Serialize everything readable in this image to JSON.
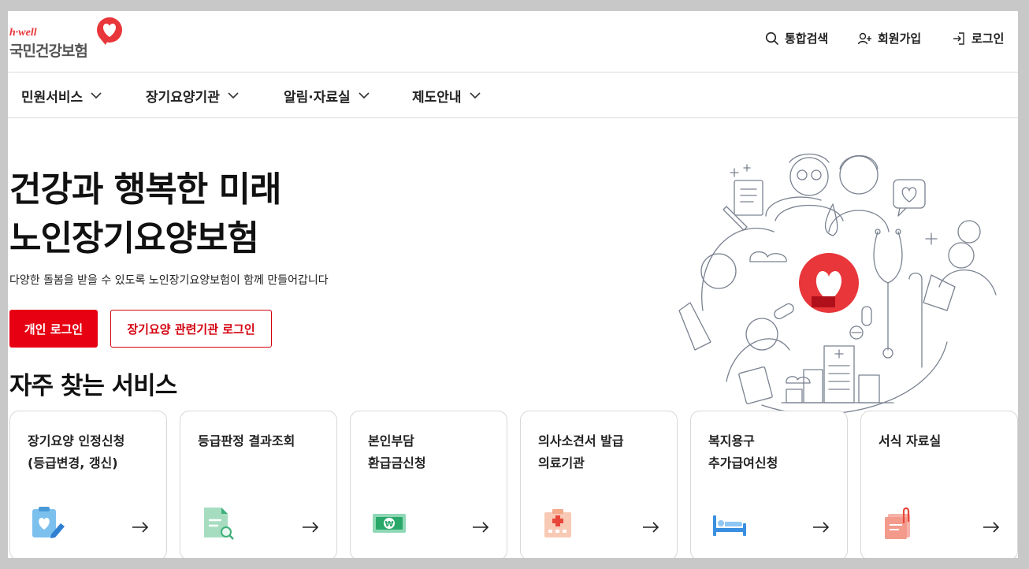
{
  "header": {
    "logo_brand": "h·well",
    "logo_name": "국민건강보험",
    "search_label": "통합검색",
    "join_label": "회원가입",
    "login_label": "로그인"
  },
  "nav": {
    "items": [
      {
        "label": "민원서비스"
      },
      {
        "label": "장기요양기관"
      },
      {
        "label": "알림·자료실"
      },
      {
        "label": "제도안내"
      }
    ]
  },
  "hero": {
    "title_line1": "건강과 행복한 미래",
    "title_line2": "노인장기요양보험",
    "description": "다양한 돌봄을 받을 수 있도록 노인장기요양보험이 함께 만들어갑니다",
    "personal_login": "개인 로그인",
    "institution_login": "장기요양 관련기관 로그인"
  },
  "services": {
    "title": "자주 찾는 서비스",
    "cards": [
      {
        "title": "장기요양 인정신청\n(등급변경, 갱신)",
        "icon": "clipboard-heart-icon"
      },
      {
        "title": "등급판정 결과조회",
        "icon": "document-search-icon"
      },
      {
        "title": "본인부담\n환급금신청",
        "icon": "won-money-icon"
      },
      {
        "title": "의사소견서 발급\n의료기관",
        "icon": "hospital-icon"
      },
      {
        "title": "복지용구\n추가급여신청",
        "icon": "bed-icon"
      },
      {
        "title": "서식 자료실",
        "icon": "paper-clip-file-icon"
      }
    ]
  },
  "colors": {
    "brand_red": "#e60012",
    "outline_red": "#d4000f"
  }
}
